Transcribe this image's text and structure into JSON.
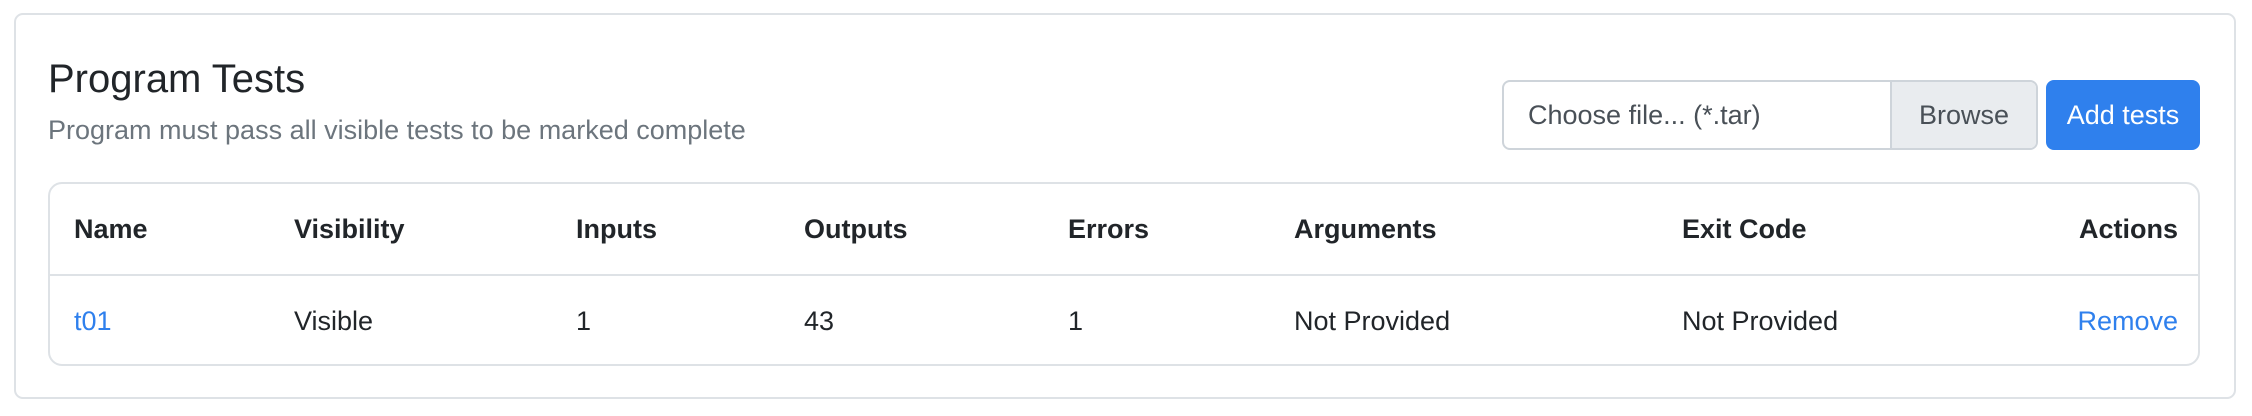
{
  "header": {
    "title": "Program Tests",
    "subtitle": "Program must pass all visible tests to be marked complete"
  },
  "upload": {
    "placeholder": "Choose file... (*.tar)",
    "browse_label": "Browse",
    "add_label": "Add tests"
  },
  "colors": {
    "accent": "#2f80ed",
    "border": "#dee2e6",
    "muted_text": "#6c757d"
  },
  "table": {
    "columns": [
      "Name",
      "Visibility",
      "Inputs",
      "Outputs",
      "Errors",
      "Arguments",
      "Exit Code",
      "Actions"
    ],
    "rows": [
      {
        "name": "t01",
        "visibility": "Visible",
        "inputs": "1",
        "outputs": "43",
        "errors": "1",
        "arguments": "Not Provided",
        "exit_code": "Not Provided",
        "action": "Remove"
      }
    ]
  }
}
